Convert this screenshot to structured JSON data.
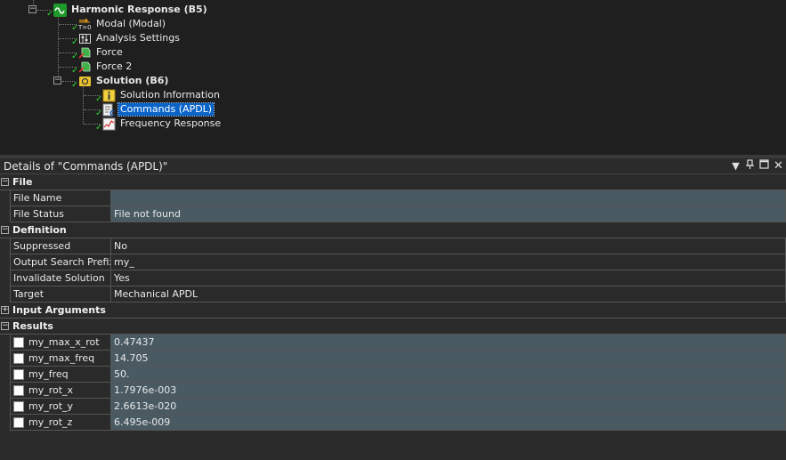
{
  "tree": {
    "items": [
      {
        "label": "Harmonic Response (B5)",
        "icon": "harmonic-response-icon",
        "bold": true
      },
      {
        "label": "Modal (Modal)",
        "icon": "modal-initial-condition-icon"
      },
      {
        "label": "Analysis Settings",
        "icon": "analysis-settings-icon"
      },
      {
        "label": "Force",
        "icon": "force-icon"
      },
      {
        "label": "Force 2",
        "icon": "force-icon"
      },
      {
        "label": "Solution (B6)",
        "icon": "solution-icon",
        "bold": true
      },
      {
        "label": "Solution Information",
        "icon": "solution-information-icon"
      },
      {
        "label": "Commands (APDL)",
        "icon": "commands-apdl-icon",
        "selected": true
      },
      {
        "label": "Frequency Response",
        "icon": "frequency-response-icon"
      }
    ],
    "modal_icon_text": "T=0"
  },
  "details": {
    "title": "Details of \"Commands (APDL)\"",
    "groups": {
      "file": "File",
      "definition": "Definition",
      "input_arguments": "Input Arguments",
      "results": "Results"
    },
    "file": {
      "name_label": "File Name",
      "name_value": "",
      "status_label": "File Status",
      "status_value": "File not found"
    },
    "definition": {
      "suppressed_label": "Suppressed",
      "suppressed_value": "No",
      "prefix_label": "Output Search Prefix",
      "prefix_value": "my_",
      "invalidate_label": "Invalidate Solution",
      "invalidate_value": "Yes",
      "target_label": "Target",
      "target_value": "Mechanical APDL"
    },
    "results": [
      {
        "name": "my_max_x_rot",
        "value": "0.47437"
      },
      {
        "name": "my_max_freq",
        "value": "14.705"
      },
      {
        "name": "my_freq",
        "value": "50."
      },
      {
        "name": "my_rot_x",
        "value": "1.7976e-003"
      },
      {
        "name": "my_rot_y",
        "value": "2.6613e-020"
      },
      {
        "name": "my_rot_z",
        "value": "6.495e-009"
      }
    ]
  },
  "colors": {
    "selection": "#0a64c8",
    "value_highlight": "#4a5a63",
    "check": "#2ed12e"
  }
}
